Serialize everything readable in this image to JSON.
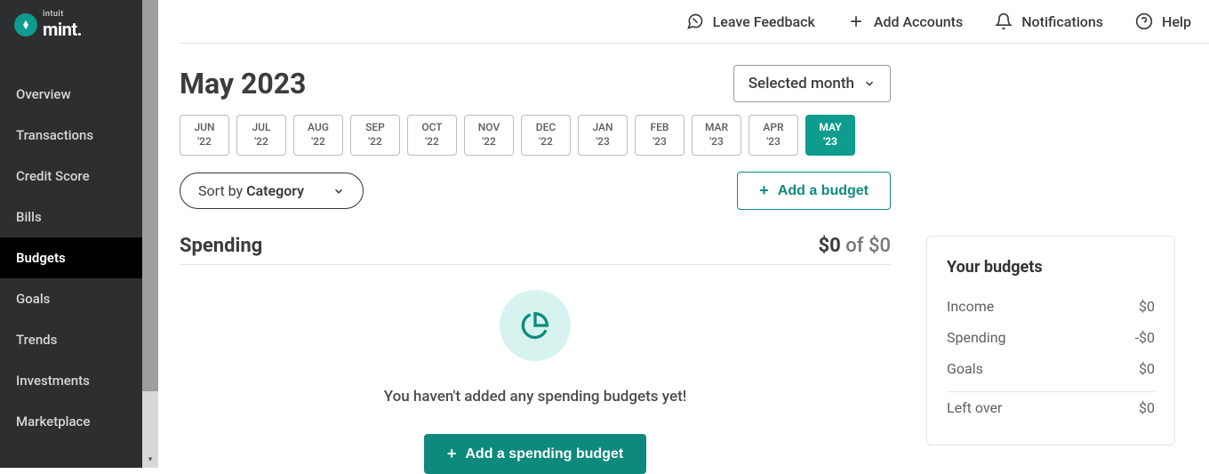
{
  "brand": {
    "intuit": "intuit",
    "mint": "mint"
  },
  "sidebar": {
    "items": [
      {
        "label": "Overview"
      },
      {
        "label": "Transactions"
      },
      {
        "label": "Credit Score"
      },
      {
        "label": "Bills"
      },
      {
        "label": "Budgets"
      },
      {
        "label": "Goals"
      },
      {
        "label": "Trends"
      },
      {
        "label": "Investments"
      },
      {
        "label": "Marketplace"
      }
    ],
    "active_index": 4
  },
  "topbar": {
    "feedback": "Leave Feedback",
    "add_accounts": "Add Accounts",
    "notifications": "Notifications",
    "help": "Help"
  },
  "header": {
    "title": "May 2023",
    "dropdown_label": "Selected month"
  },
  "months": [
    {
      "m": "JUN",
      "y": "'22"
    },
    {
      "m": "JUL",
      "y": "'22"
    },
    {
      "m": "AUG",
      "y": "'22"
    },
    {
      "m": "SEP",
      "y": "'22"
    },
    {
      "m": "OCT",
      "y": "'22"
    },
    {
      "m": "NOV",
      "y": "'22"
    },
    {
      "m": "DEC",
      "y": "'22"
    },
    {
      "m": "JAN",
      "y": "'23"
    },
    {
      "m": "FEB",
      "y": "'23"
    },
    {
      "m": "MAR",
      "y": "'23"
    },
    {
      "m": "APR",
      "y": "'23"
    },
    {
      "m": "MAY",
      "y": "'23"
    }
  ],
  "months_active_index": 11,
  "sort": {
    "prefix": "Sort by ",
    "value": "Category"
  },
  "add_budget": "Add a budget",
  "spending": {
    "title": "Spending",
    "spent": "$0",
    "of": " of ",
    "total": "$0",
    "empty_text": "You haven't added any spending budgets yet!",
    "add_button": "Add a spending budget"
  },
  "summary": {
    "title": "Your budgets",
    "rows": [
      {
        "label": "Income",
        "value": "$0"
      },
      {
        "label": "Spending",
        "value": "-$0"
      },
      {
        "label": "Goals",
        "value": "$0"
      }
    ],
    "leftover_label": "Left over",
    "leftover_value": "$0"
  }
}
